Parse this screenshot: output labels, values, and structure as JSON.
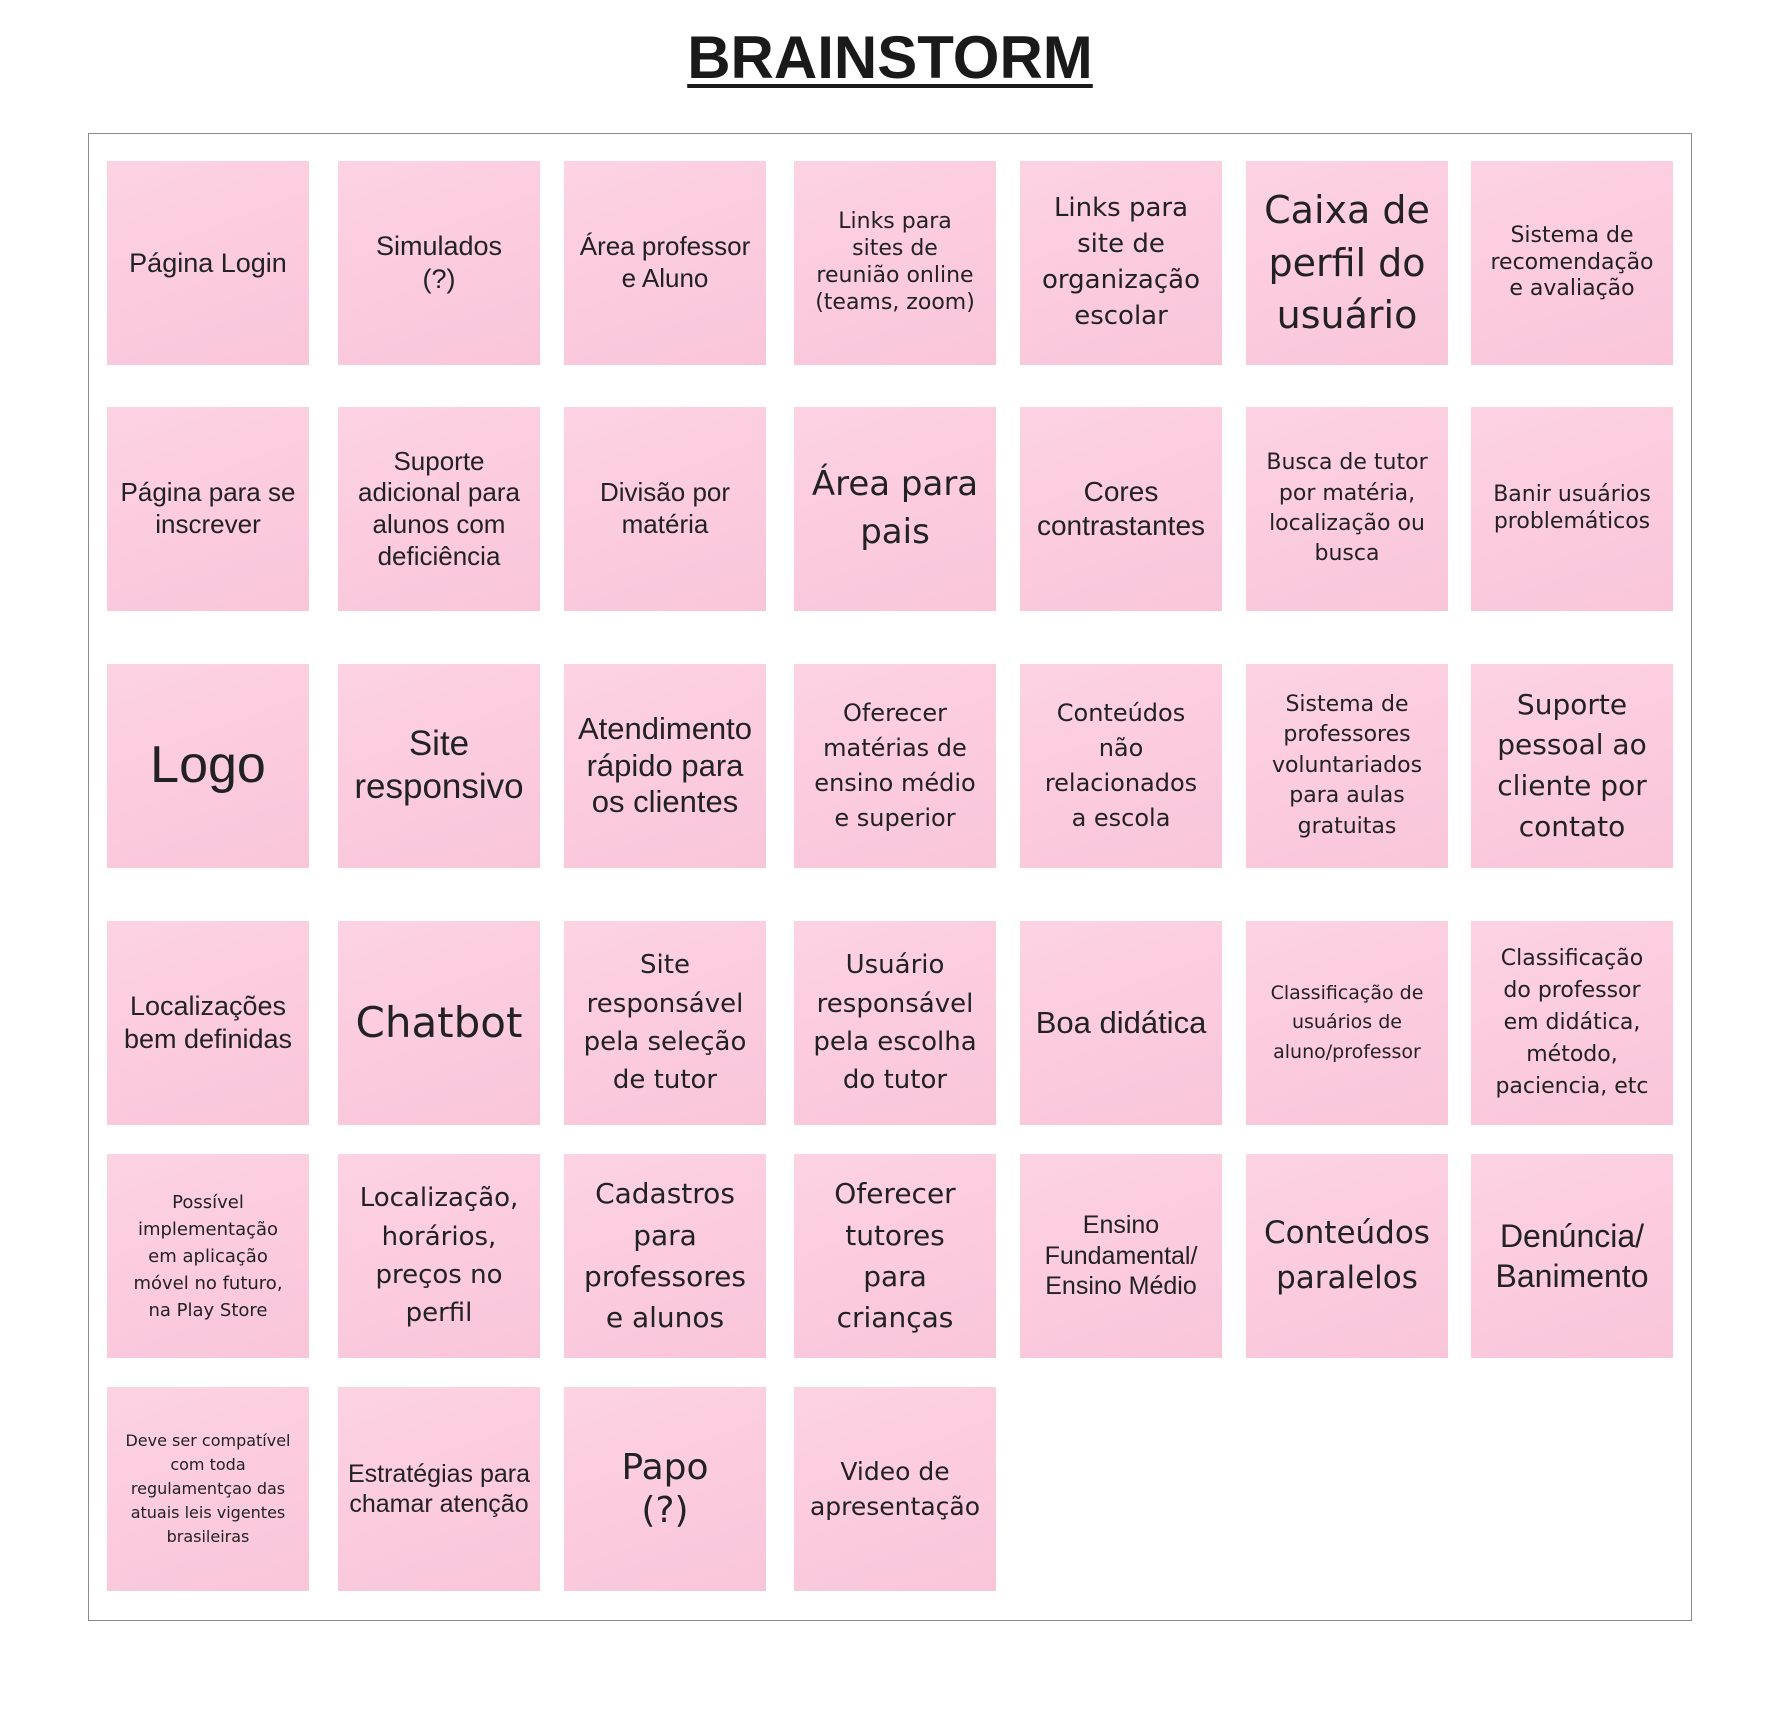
{
  "title": "BRAINSTORM",
  "notes": [
    {
      "text": "Página Login"
    },
    {
      "text": "Simulados\n(?)"
    },
    {
      "text": "Área professor\ne Aluno"
    },
    {
      "text": "Links para\nsites de\nreunião online\n(teams, zoom)"
    },
    {
      "text": "Links para\nsite de\norganização\nescolar"
    },
    {
      "text": "Caixa de\nperfil do\nusuário"
    },
    {
      "text": "Sistema de\nrecomendação\ne avaliação"
    },
    {
      "text": "Página para se\ninscrever"
    },
    {
      "text": "Suporte\nadicional para\nalunos com\ndeficiência"
    },
    {
      "text": "Divisão por\nmatéria"
    },
    {
      "text": "Área para\npais"
    },
    {
      "text": "Cores\ncontrastantes"
    },
    {
      "text": "Busca de tutor\npor matéria,\nlocalização ou\nbusca"
    },
    {
      "text": "Banir usuários\nproblemáticos"
    },
    {
      "text": "Logo"
    },
    {
      "text": "Site\nresponsivo"
    },
    {
      "text": "Atendimento\nrápido para\nos clientes"
    },
    {
      "text": "Oferecer\nmatérias de\nensino médio\ne superior"
    },
    {
      "text": "Conteúdos\nnão\nrelacionados\na escola"
    },
    {
      "text": "Sistema de\nprofessores\nvoluntariados\npara aulas\ngratuitas"
    },
    {
      "text": "Suporte\npessoal ao\ncliente por\ncontato"
    },
    {
      "text": "Localizações\nbem definidas"
    },
    {
      "text": "Chatbot"
    },
    {
      "text": "Site\nresponsável\npela seleção\nde tutor"
    },
    {
      "text": "Usuário\nresponsável\npela escolha\ndo tutor"
    },
    {
      "text": "Boa didática"
    },
    {
      "text": "Classificação de\nusuários de\naluno/professor"
    },
    {
      "text": "Classificação\ndo professor\nem didática,\nmétodo,\npaciencia, etc"
    },
    {
      "text": "Possível\nimplementação\nem aplicação\nmóvel no futuro,\nna Play Store"
    },
    {
      "text": "Localização,\nhorários,\npreços no\nperfil"
    },
    {
      "text": "Cadastros\npara\nprofessores\ne alunos"
    },
    {
      "text": "Oferecer\ntutores\npara\ncrianças"
    },
    {
      "text": "Ensino\nFundamental/\nEnsino Médio"
    },
    {
      "text": "Conteúdos\nparalelos"
    },
    {
      "text": "Denúncia/\nBanimento"
    },
    {
      "text": "Deve ser compatível\ncom toda\nregulamentçao das\natuais leis vigentes\nbrasileiras"
    },
    {
      "text": "Estratégias para\nchamar atenção"
    },
    {
      "text": "Papo\n(?)"
    },
    {
      "text": "Video de\napresentação"
    }
  ],
  "colors": {
    "note_background": "#fbcadd",
    "board_border": "#8a8a8a",
    "text": "#222222"
  }
}
